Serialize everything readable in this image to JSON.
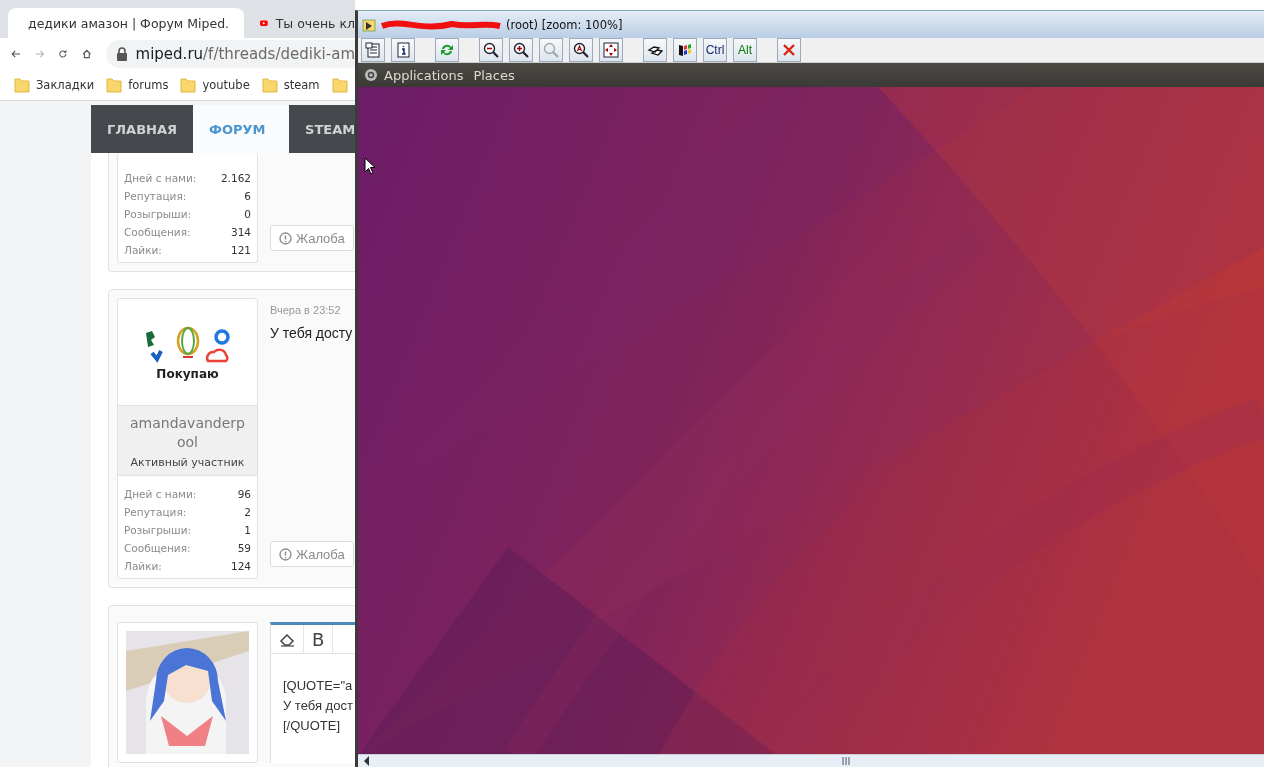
{
  "browser": {
    "tabs": [
      {
        "title": "дедики амазон | Форум Miped.",
        "selected": true
      },
      {
        "title": "Ты очень кл",
        "selected": false
      }
    ],
    "address": {
      "host": "miped.ru",
      "path": "/f/threads/dediki-am"
    },
    "bookmarks": [
      "Закладки",
      "forums",
      "youtube",
      "steam"
    ]
  },
  "nav": [
    {
      "label": "ГЛАВНАЯ",
      "selected": false
    },
    {
      "label": "ФОРУМ",
      "selected": true
    },
    {
      "label": "STEAM",
      "selected": false
    }
  ],
  "posts": [
    {
      "kind": "stats",
      "stats": [
        {
          "label": "Дней с нами:",
          "value": "2.162"
        },
        {
          "label": "Репутация:",
          "value": "6"
        },
        {
          "label": "Розыгрыши:",
          "value": "0"
        },
        {
          "label": "Сообщения:",
          "value": "314"
        },
        {
          "label": "Лайки:",
          "value": "121"
        }
      ],
      "report": "Жалоба"
    },
    {
      "kind": "full",
      "avatar_caption": "Покупаю",
      "username": "amandavanderpool",
      "role": "Активный участник",
      "date": "Вчера в 23:52",
      "text": "У тебя досту",
      "stats": [
        {
          "label": "Дней с нами:",
          "value": "96"
        },
        {
          "label": "Репутация:",
          "value": "2"
        },
        {
          "label": "Розыгрыши:",
          "value": "1"
        },
        {
          "label": "Сообщения:",
          "value": "59"
        },
        {
          "label": "Лайки:",
          "value": "124"
        }
      ],
      "report": "Жалоба"
    },
    {
      "kind": "editor",
      "bold_button": "B",
      "lines": [
        "[QUOTE=\"a",
        "У тебя дост",
        "[/QUOTE]"
      ]
    }
  ],
  "vnc": {
    "title": "(root) [zoom: 100%]",
    "toolbar": [
      [
        {
          "kind": "icon",
          "disabled": false
        },
        {
          "kind": "icon",
          "disabled": false
        }
      ],
      [
        {
          "kind": "icon",
          "disabled": false
        }
      ],
      [
        {
          "kind": "icon",
          "disabled": false
        },
        {
          "kind": "icon",
          "disabled": false
        },
        {
          "kind": "icon",
          "disabled": true
        },
        {
          "kind": "icon",
          "disabled": false
        },
        {
          "kind": "icon",
          "disabled": false
        }
      ],
      [
        {
          "kind": "icon",
          "disabled": false
        },
        {
          "kind": "icon",
          "disabled": false
        },
        {
          "kind": "text",
          "label": "Ctrl"
        },
        {
          "kind": "text",
          "label": "Alt"
        }
      ],
      [
        {
          "kind": "icon",
          "disabled": false
        }
      ]
    ],
    "panel_menus": [
      "Applications",
      "Places"
    ]
  }
}
